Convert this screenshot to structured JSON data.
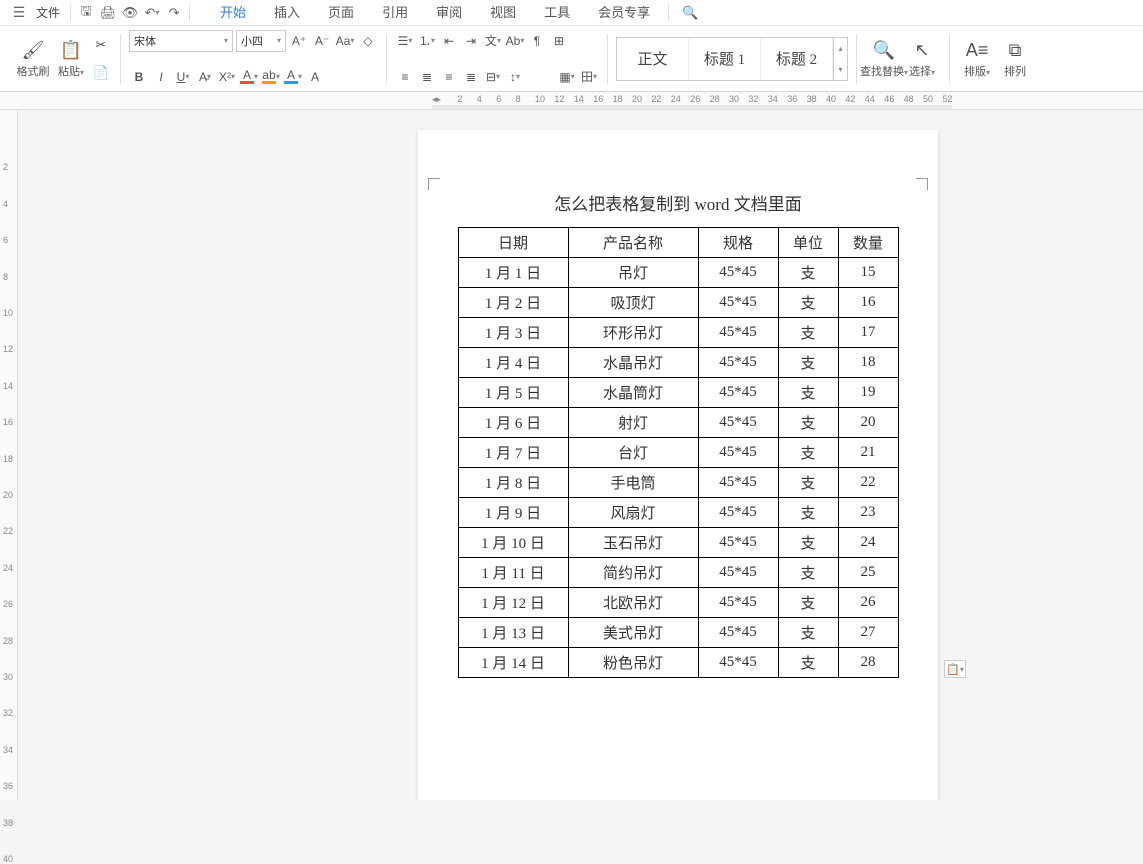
{
  "menu": {
    "file": "文件",
    "tabs": [
      "开始",
      "插入",
      "页面",
      "引用",
      "审阅",
      "视图",
      "工具",
      "会员专享"
    ],
    "active_index": 0
  },
  "ribbon": {
    "format_painter": "格式刷",
    "paste": "粘贴",
    "font_name": "宋体",
    "font_size": "小四",
    "find_replace": "查找替换",
    "select": "选择",
    "layout": "排版",
    "arrange": "排列",
    "styles": {
      "body": "正文",
      "heading1": "标题 1",
      "heading2": "标题 2"
    }
  },
  "ruler_h": [
    2,
    4,
    6,
    8,
    10,
    12,
    14,
    16,
    18,
    20,
    22,
    24,
    26,
    28,
    30,
    32,
    34,
    36,
    38,
    40,
    42,
    44,
    46,
    48,
    50,
    52
  ],
  "ruler_v": [
    2,
    4,
    6,
    8,
    10,
    12,
    14,
    16,
    18,
    20,
    22,
    24,
    26,
    28,
    30,
    32,
    34,
    36,
    38,
    40
  ],
  "document": {
    "title": "怎么把表格复制到 word 文档里面",
    "columns": [
      "日期",
      "产品名称",
      "规格",
      "单位",
      "数量"
    ],
    "rows": [
      [
        "1 月 1 日",
        "吊灯",
        "45*45",
        "支",
        "15"
      ],
      [
        "1 月 2 日",
        "吸顶灯",
        "45*45",
        "支",
        "16"
      ],
      [
        "1 月 3 日",
        "环形吊灯",
        "45*45",
        "支",
        "17"
      ],
      [
        "1 月 4 日",
        "水晶吊灯",
        "45*45",
        "支",
        "18"
      ],
      [
        "1 月 5 日",
        "水晶筒灯",
        "45*45",
        "支",
        "19"
      ],
      [
        "1 月 6 日",
        "射灯",
        "45*45",
        "支",
        "20"
      ],
      [
        "1 月 7 日",
        "台灯",
        "45*45",
        "支",
        "21"
      ],
      [
        "1 月 8 日",
        "手电筒",
        "45*45",
        "支",
        "22"
      ],
      [
        "1 月 9 日",
        "风扇灯",
        "45*45",
        "支",
        "23"
      ],
      [
        "1 月 10 日",
        "玉石吊灯",
        "45*45",
        "支",
        "24"
      ],
      [
        "1 月 11 日",
        "简约吊灯",
        "45*45",
        "支",
        "25"
      ],
      [
        "1 月 12 日",
        "北欧吊灯",
        "45*45",
        "支",
        "26"
      ],
      [
        "1 月 13 日",
        "美式吊灯",
        "45*45",
        "支",
        "27"
      ],
      [
        "1 月 14 日",
        "粉色吊灯",
        "45*45",
        "支",
        "28"
      ]
    ]
  }
}
